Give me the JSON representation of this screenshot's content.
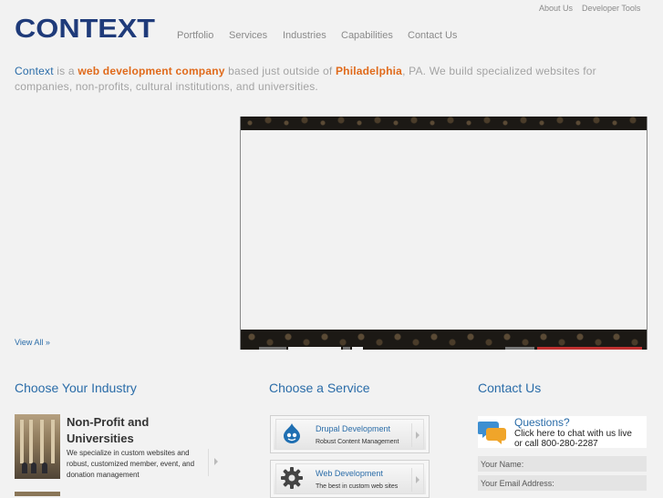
{
  "logo": {
    "text": "CONTEXT"
  },
  "top_links": {
    "about": "About Us",
    "dev_tools": "Developer Tools"
  },
  "nav": {
    "items": [
      "Portfolio",
      "Services",
      "Industries",
      "Capabilities",
      "Contact Us"
    ]
  },
  "intro": {
    "company": "Context",
    "part1": " is a ",
    "highlight1": "web development company",
    "part2": " based just outside of ",
    "highlight2": "Philadelphia",
    "part3": ", PA. We build specialized websites for companies, non-profits, cultural institutions, and universities."
  },
  "portfolio": {
    "view_all": "View All »"
  },
  "industry": {
    "heading": "Choose Your Industry",
    "item_title": "Non-Profit and Universities",
    "item_desc": "We specialize in custom websites and robust, customized member, event, and donation management"
  },
  "services": {
    "heading": "Choose a Service",
    "items": [
      {
        "title": "Drupal Development",
        "subtitle": "Robust Content Management",
        "icon": "drupal-icon"
      },
      {
        "title": "Web Development",
        "subtitle": "The best in custom web sites",
        "icon": "gear-icon"
      }
    ]
  },
  "contact": {
    "heading": "Contact Us",
    "chat_title": "Questions?",
    "chat_line1": "Click here to chat with us live",
    "chat_line2": "or call 800-280-2287",
    "name_placeholder": "Your Name:",
    "email_placeholder": "Your Email Address:"
  },
  "colors": {
    "accent": "#2a6ca8",
    "highlight": "#e06a1b",
    "logo": "#1f3b7a"
  }
}
